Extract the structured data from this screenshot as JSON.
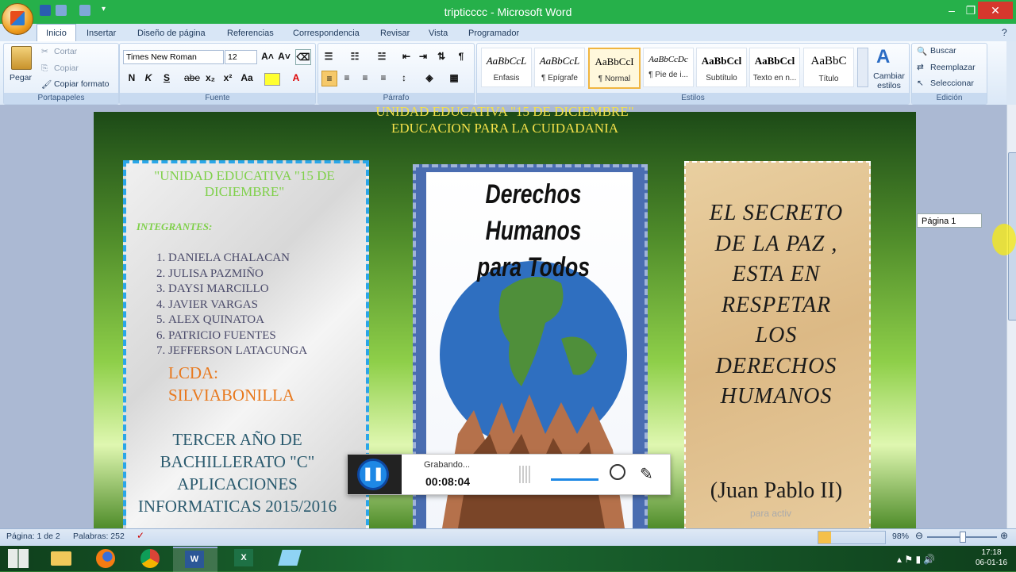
{
  "window": {
    "title": "tripticccc - Microsoft Word"
  },
  "tabs": [
    "Inicio",
    "Insertar",
    "Diseño de página",
    "Referencias",
    "Correspondencia",
    "Revisar",
    "Vista",
    "Programador"
  ],
  "clipboard": {
    "paste": "Pegar",
    "cut": "Cortar",
    "copy": "Copiar",
    "format_painter": "Copiar formato",
    "label": "Portapapeles"
  },
  "font": {
    "name": "Times New Roman",
    "size": "12",
    "label": "Fuente",
    "bold": "N",
    "italic": "K",
    "underline": "S",
    "strike": "abe",
    "sub": "x₂",
    "sup": "x²",
    "case": "Aa"
  },
  "paragraph": {
    "label": "Párrafo"
  },
  "styles": {
    "label": "Estilos",
    "items": [
      {
        "preview": "AaBbCcL",
        "name": "Énfasis"
      },
      {
        "preview": "AaBbCcL",
        "name": "¶ Epígrafe"
      },
      {
        "preview": "AaBbCcI",
        "name": "¶ Normal"
      },
      {
        "preview": "AaBbCcDc",
        "name": "¶ Pie de i..."
      },
      {
        "preview": "AaBbCcl",
        "name": "Subtítulo"
      },
      {
        "preview": "AaBbCcl",
        "name": "Texto en n..."
      },
      {
        "preview": "AaBbC",
        "name": "Título"
      }
    ],
    "change": "Cambiar estilos"
  },
  "editing": {
    "find": "Buscar",
    "replace": "Reemplazar",
    "select": "Seleccionar",
    "label": "Edición"
  },
  "document": {
    "header_line1": "UNIDAD EDUCATIVA \"15 DE DICIEMBRE\"",
    "header_line2": "EDUCACION PARA LA CUIDADANIA",
    "left": {
      "school": "\"UNIDAD EDUCATIVA \"15 DE DICIEMBRE\"",
      "members_heading": "INTEGRANTES:",
      "members": [
        "DANIELA CHALACAN",
        "JULISA PAZMIÑO",
        "DAYSI MARCILLO",
        "JAVIER VARGAS",
        "ALEX QUINATOA",
        "PATRICIO FUENTES",
        "JEFFERSON  LATACUNGA"
      ],
      "teacher": "LCDA: SILVIABONILLA",
      "course": "TERCER AÑO DE BACHILLERATO \"C\" APLICACIONES INFORMATICAS 2015/2016"
    },
    "middle": {
      "poster_title_1": "Derechos Humanos",
      "poster_title_2": "para Todos"
    },
    "right": {
      "quote": "EL SECRETO DE LA PAZ , ESTA EN RESPETAR LOS DERECHOS HUMANOS",
      "author": "(Juan Pablo II)"
    },
    "page_tooltip": "Página 1"
  },
  "recorder": {
    "status": "Grabando...",
    "time": "00:08:04"
  },
  "statusbar": {
    "page": "Página: 1 de 2",
    "words": "Palabras: 252",
    "zoom": "98%"
  },
  "watermark": "para activ",
  "clock": {
    "time": "17:18",
    "date": "06-01-16"
  }
}
